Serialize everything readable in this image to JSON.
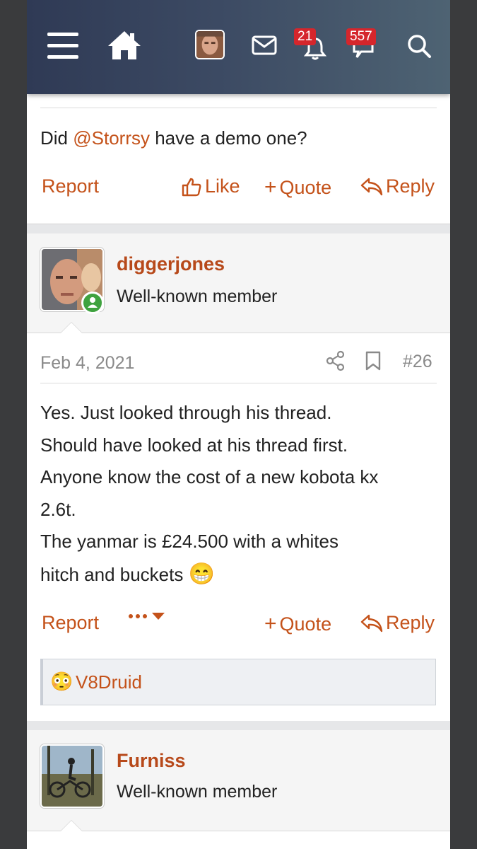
{
  "header": {
    "notifications_count": "21",
    "messages_count": "557"
  },
  "post_prev": {
    "text_prefix": "Did ",
    "mention": "@Storrsy",
    "text_suffix": " have a demo one?",
    "actions": {
      "report": "Report",
      "like": "Like",
      "quote": "Quote",
      "reply": "Reply"
    }
  },
  "post_26": {
    "username": "diggerjones",
    "user_title": "Well-known member",
    "date": "Feb 4, 2021",
    "number": "#26",
    "lines": [
      "Yes. Just looked through his thread.",
      "Should have looked at his thread first.",
      "Anyone know the cost of a new kobota kx",
      "2.6t.",
      "The yanmar is £24.500 with a whites",
      "hitch and buckets"
    ],
    "emoji": "😁",
    "actions": {
      "report": "Report",
      "quote": "Quote",
      "reply": "Reply"
    },
    "reaction_user": "V8Druid",
    "reaction_emoji": "😳"
  },
  "post_next": {
    "username": "Furniss",
    "user_title": "Well-known member"
  },
  "colors": {
    "accent": "#c4521a",
    "badge": "#d5262c",
    "online": "#3fa23f"
  }
}
